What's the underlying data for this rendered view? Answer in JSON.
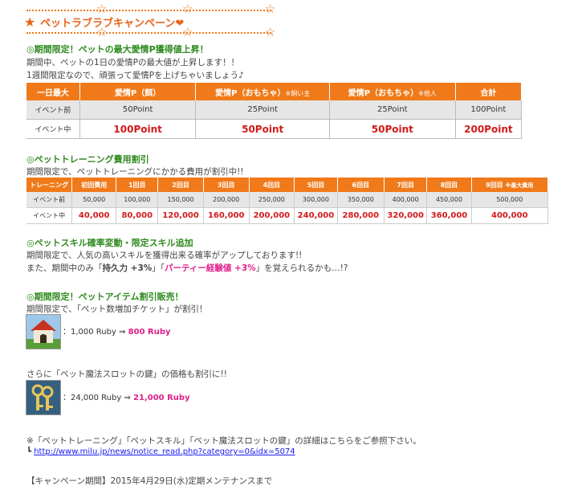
{
  "header": {
    "title": "ペットラブラブキャンペーン",
    "heart": "❤",
    "lead_star": "★",
    "deco_star": "☆"
  },
  "sec1": {
    "heading": "◎期間限定！ペットの最大愛情P獲得値上昇！",
    "line1": "期間中、ペットの1日の愛情Pの最大値が上昇します！！",
    "line2": "1週間限定なので、頑張って愛情Pを上げちゃいましょう♪",
    "table": {
      "headers": [
        "一日最大",
        "愛情P（餌）",
        "愛情P（おもちゃ）",
        "愛情P（おもちゃ）",
        "合計"
      ],
      "subheaders": [
        "",
        "",
        "※飼い主",
        "※他人",
        ""
      ],
      "rows": [
        [
          "イベント前",
          "50Point",
          "25Point",
          "25Point",
          "100Point"
        ],
        [
          "イベント中",
          "100Point",
          "50Point",
          "50Point",
          "200Point"
        ]
      ]
    }
  },
  "sec2": {
    "heading": "◎ペットトレーニング費用割引",
    "line1": "期間限定で、ペットトレーニングにかかる費用が割引中!!",
    "table": {
      "headers": [
        "トレーニング",
        "初回費用",
        "1回目",
        "2回目",
        "3回目",
        "4回目",
        "5回目",
        "6回目",
        "7回目",
        "8回目",
        "9回目"
      ],
      "last_note": "※最大費用",
      "rows": [
        [
          "イベント前",
          "50,000",
          "100,000",
          "150,000",
          "200,000",
          "250,000",
          "300,000",
          "350,000",
          "400,000",
          "450,000",
          "500,000"
        ],
        [
          "イベント中",
          "40,000",
          "80,000",
          "120,000",
          "160,000",
          "200,000",
          "240,000",
          "280,000",
          "320,000",
          "360,000",
          "400,000"
        ]
      ]
    }
  },
  "sec3": {
    "heading": "◎ペットスキル確率変動・限定スキル追加",
    "line1": "期間限定で、人気の高いスキルを獲得出来る確率がアップしております!!",
    "line2_pre": "また、期間中のみ「",
    "skill1": "持久力 +3%",
    "line2_mid": "」「",
    "skill2": "パーティー経験値 +3%",
    "line2_post": "」を覚えられるかも…!?"
  },
  "sec4": {
    "heading": "◎期間限定！ペットアイテム割引販売！",
    "line1": "期間限定で、「ペット数増加チケット」が割引！",
    "item1_old": "：1,000 Ruby ⇒ ",
    "item1_new": "800 Ruby",
    "line2": "さらに「ペット魔法スロットの鍵」の価格も割引に!!",
    "item2_old": "：24,000 Ruby ⇒ ",
    "item2_new": "21,000 Ruby"
  },
  "footer": {
    "note": "※「ペットトレーニング」「ペットスキル」「ペット魔法スロットの鍵」の詳細はこちらをご参照下さい。",
    "link_prefix": "┗",
    "link": "http://www.milu.jp/news/notice_read.php?category=0&idx=5074",
    "period": "【キャンペーン期間】2015年4月29日(水)定期メンテナンスまで"
  },
  "icons": [
    "doghouse-icon",
    "keys-icon"
  ]
}
